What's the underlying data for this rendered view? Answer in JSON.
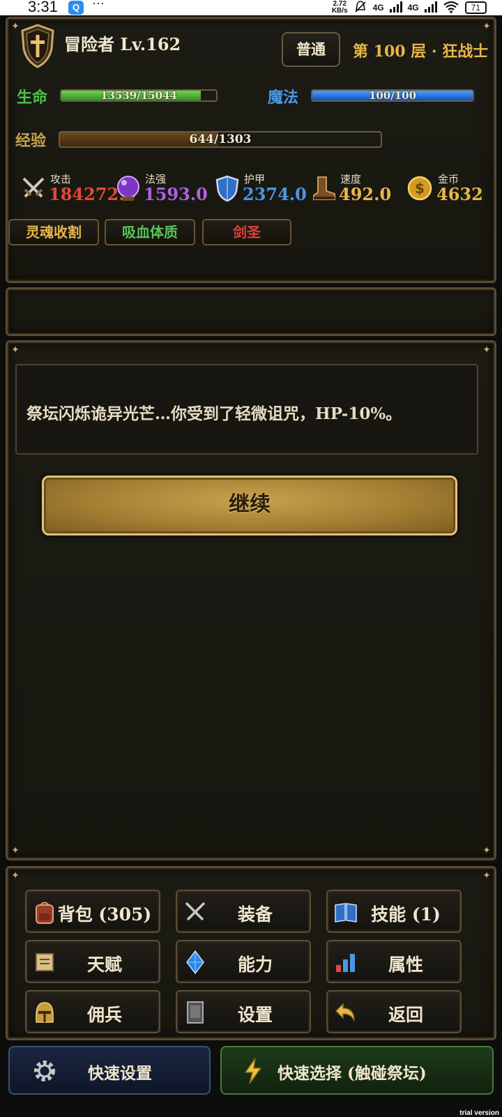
{
  "status_bar": {
    "time": "3:31",
    "app_badge": "Q",
    "dots": "···",
    "net_speed": "2.72\nKB/s",
    "signal1": "4G",
    "signal2": "4G",
    "wifi_badge": "6",
    "battery": "71"
  },
  "header": {
    "title": "冒险者 Lv.162",
    "mode_label": "普通",
    "floor": "第 100 层 · 狂战士"
  },
  "bars": {
    "hp_label": "生命",
    "hp_text": "13539/15044",
    "hp_fraction": 0.9,
    "mp_label": "魔法",
    "mp_text": "100/100",
    "mp_fraction": 1.0,
    "xp_label": "经验",
    "xp_text": "644/1303",
    "xp_fraction": 0.494
  },
  "stats": [
    {
      "name": "攻击",
      "value": "184272.0",
      "color": "#e0493c",
      "icon": "crossed-swords-icon"
    },
    {
      "name": "法强",
      "value": "1593.0",
      "color": "#b061e3",
      "icon": "magic-orb-icon"
    },
    {
      "name": "护甲",
      "value": "2374.0",
      "color": "#4a97e6",
      "icon": "shield-icon"
    },
    {
      "name": "速度",
      "value": "492.0",
      "color": "#e9b64a",
      "icon": "boot-icon"
    },
    {
      "name": "金币",
      "value": "4632",
      "color": "#e9b64a",
      "icon": "gold-coin-icon"
    }
  ],
  "tags": [
    {
      "label": "灵魂收割",
      "color": "#e9b64a"
    },
    {
      "label": "吸血体质",
      "color": "#58c45a"
    },
    {
      "label": "剑圣",
      "color": "#e0403a"
    }
  ],
  "event": {
    "message": "祭坛闪烁诡异光芒…你受到了轻微诅咒，HP-10%。",
    "continue_label": "继续"
  },
  "menu": [
    {
      "label": "背包 (305)",
      "icon": "backpack-icon"
    },
    {
      "label": "装备",
      "icon": "crossed-swords-icon"
    },
    {
      "label": "技能 (1)",
      "icon": "book-icon"
    },
    {
      "label": "天赋",
      "icon": "scroll-icon"
    },
    {
      "label": "能力",
      "icon": "blue-gem-icon"
    },
    {
      "label": "属性",
      "icon": "bar-chart-icon"
    },
    {
      "label": "佣兵",
      "icon": "helmet-icon"
    },
    {
      "label": "设置",
      "icon": "settings-book-icon"
    },
    {
      "label": "返回",
      "icon": "return-arrow-icon"
    }
  ],
  "quick": {
    "settings_label": "快速设置",
    "select_label": "快速选择 (触碰祭坛)"
  },
  "watermark": "trial version"
}
